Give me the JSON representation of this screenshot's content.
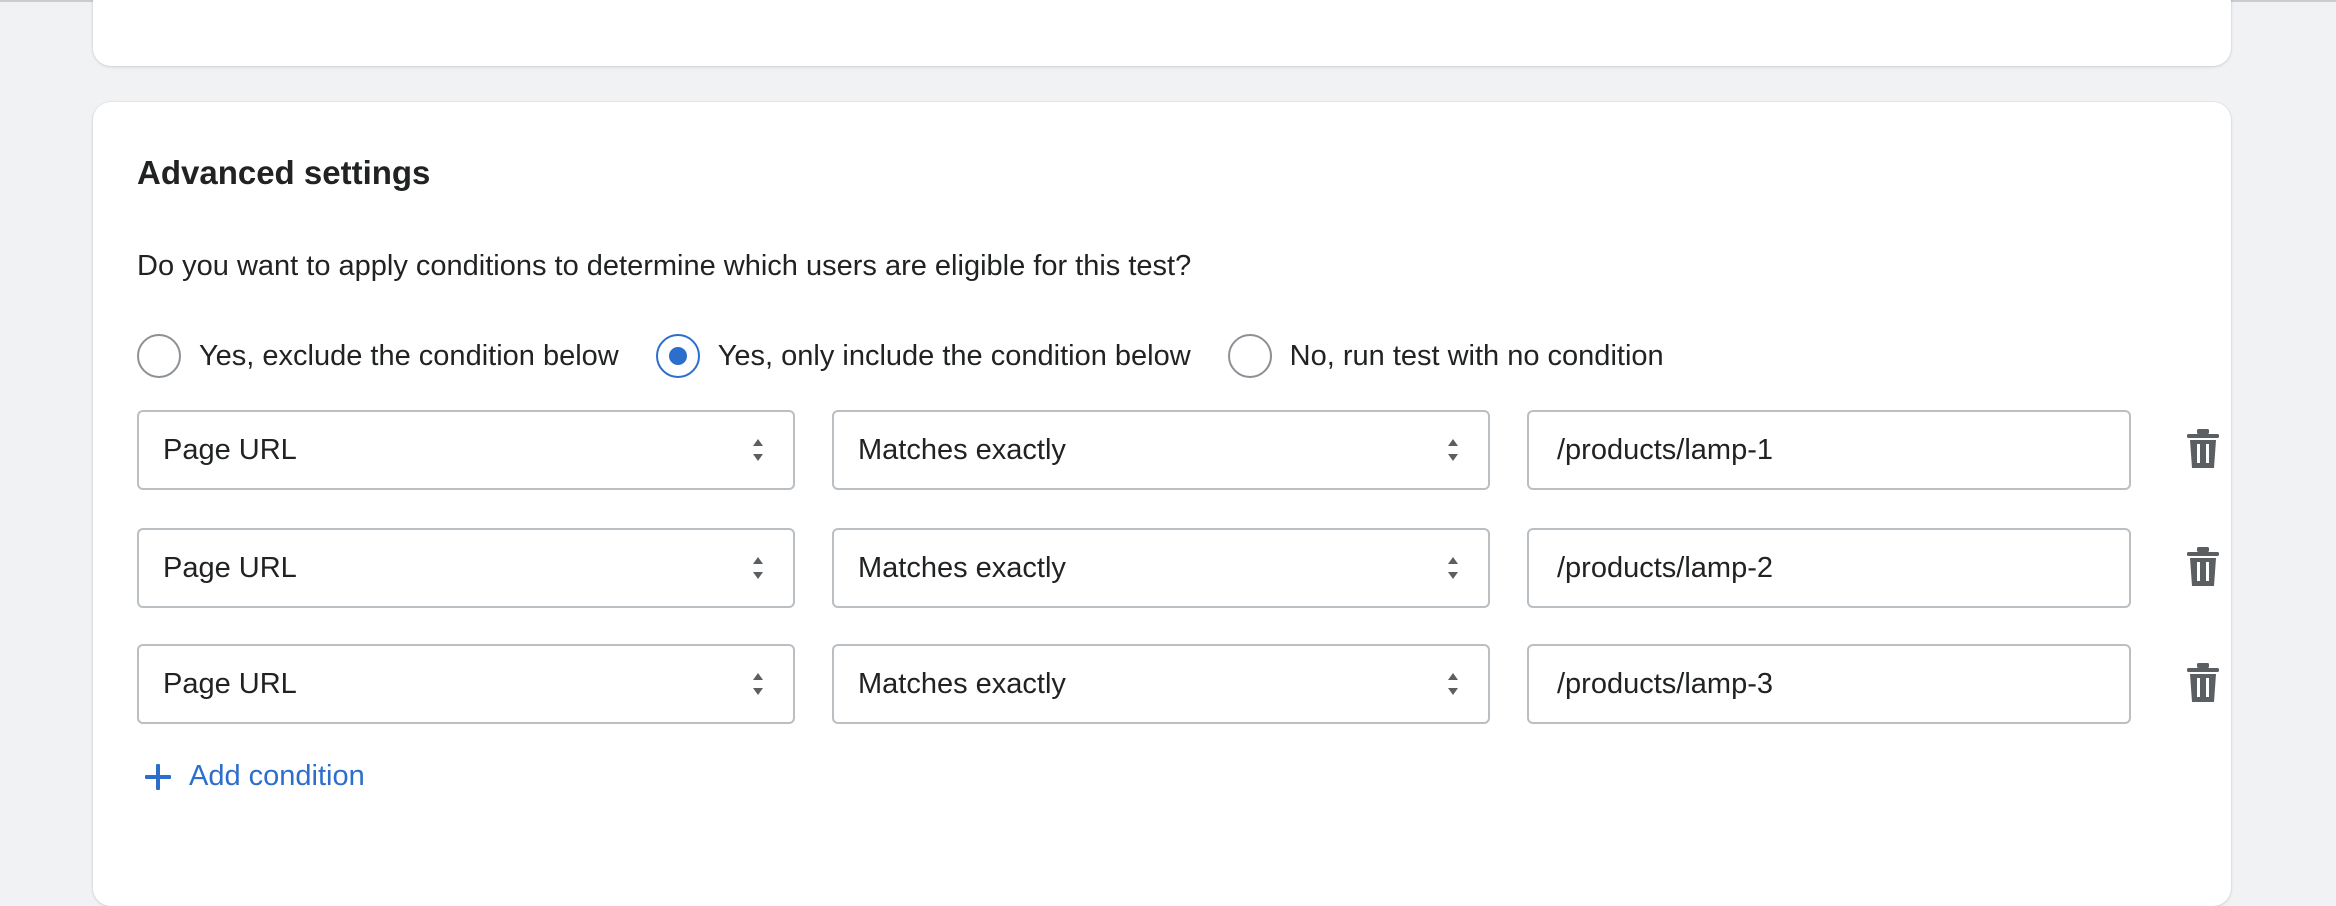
{
  "section": {
    "title": "Advanced settings",
    "question": "Do you want to apply conditions to determine which users are eligible for this test?"
  },
  "radio_options": [
    {
      "label": "Yes, exclude the condition below",
      "selected": false
    },
    {
      "label": "Yes, only include the condition below",
      "selected": true
    },
    {
      "label": "No, run test with no condition",
      "selected": false
    }
  ],
  "conditions": [
    {
      "field": "Page URL",
      "operator": "Matches exactly",
      "value": "/products/lamp-1"
    },
    {
      "field": "Page URL",
      "operator": "Matches exactly",
      "value": "/products/lamp-2"
    },
    {
      "field": "Page URL",
      "operator": "Matches exactly",
      "value": "/products/lamp-3"
    }
  ],
  "add_condition_label": "Add condition",
  "colors": {
    "accent": "#2c6ecb",
    "border": "#babfc3",
    "background": "#f1f2f4",
    "card": "#ffffff"
  }
}
